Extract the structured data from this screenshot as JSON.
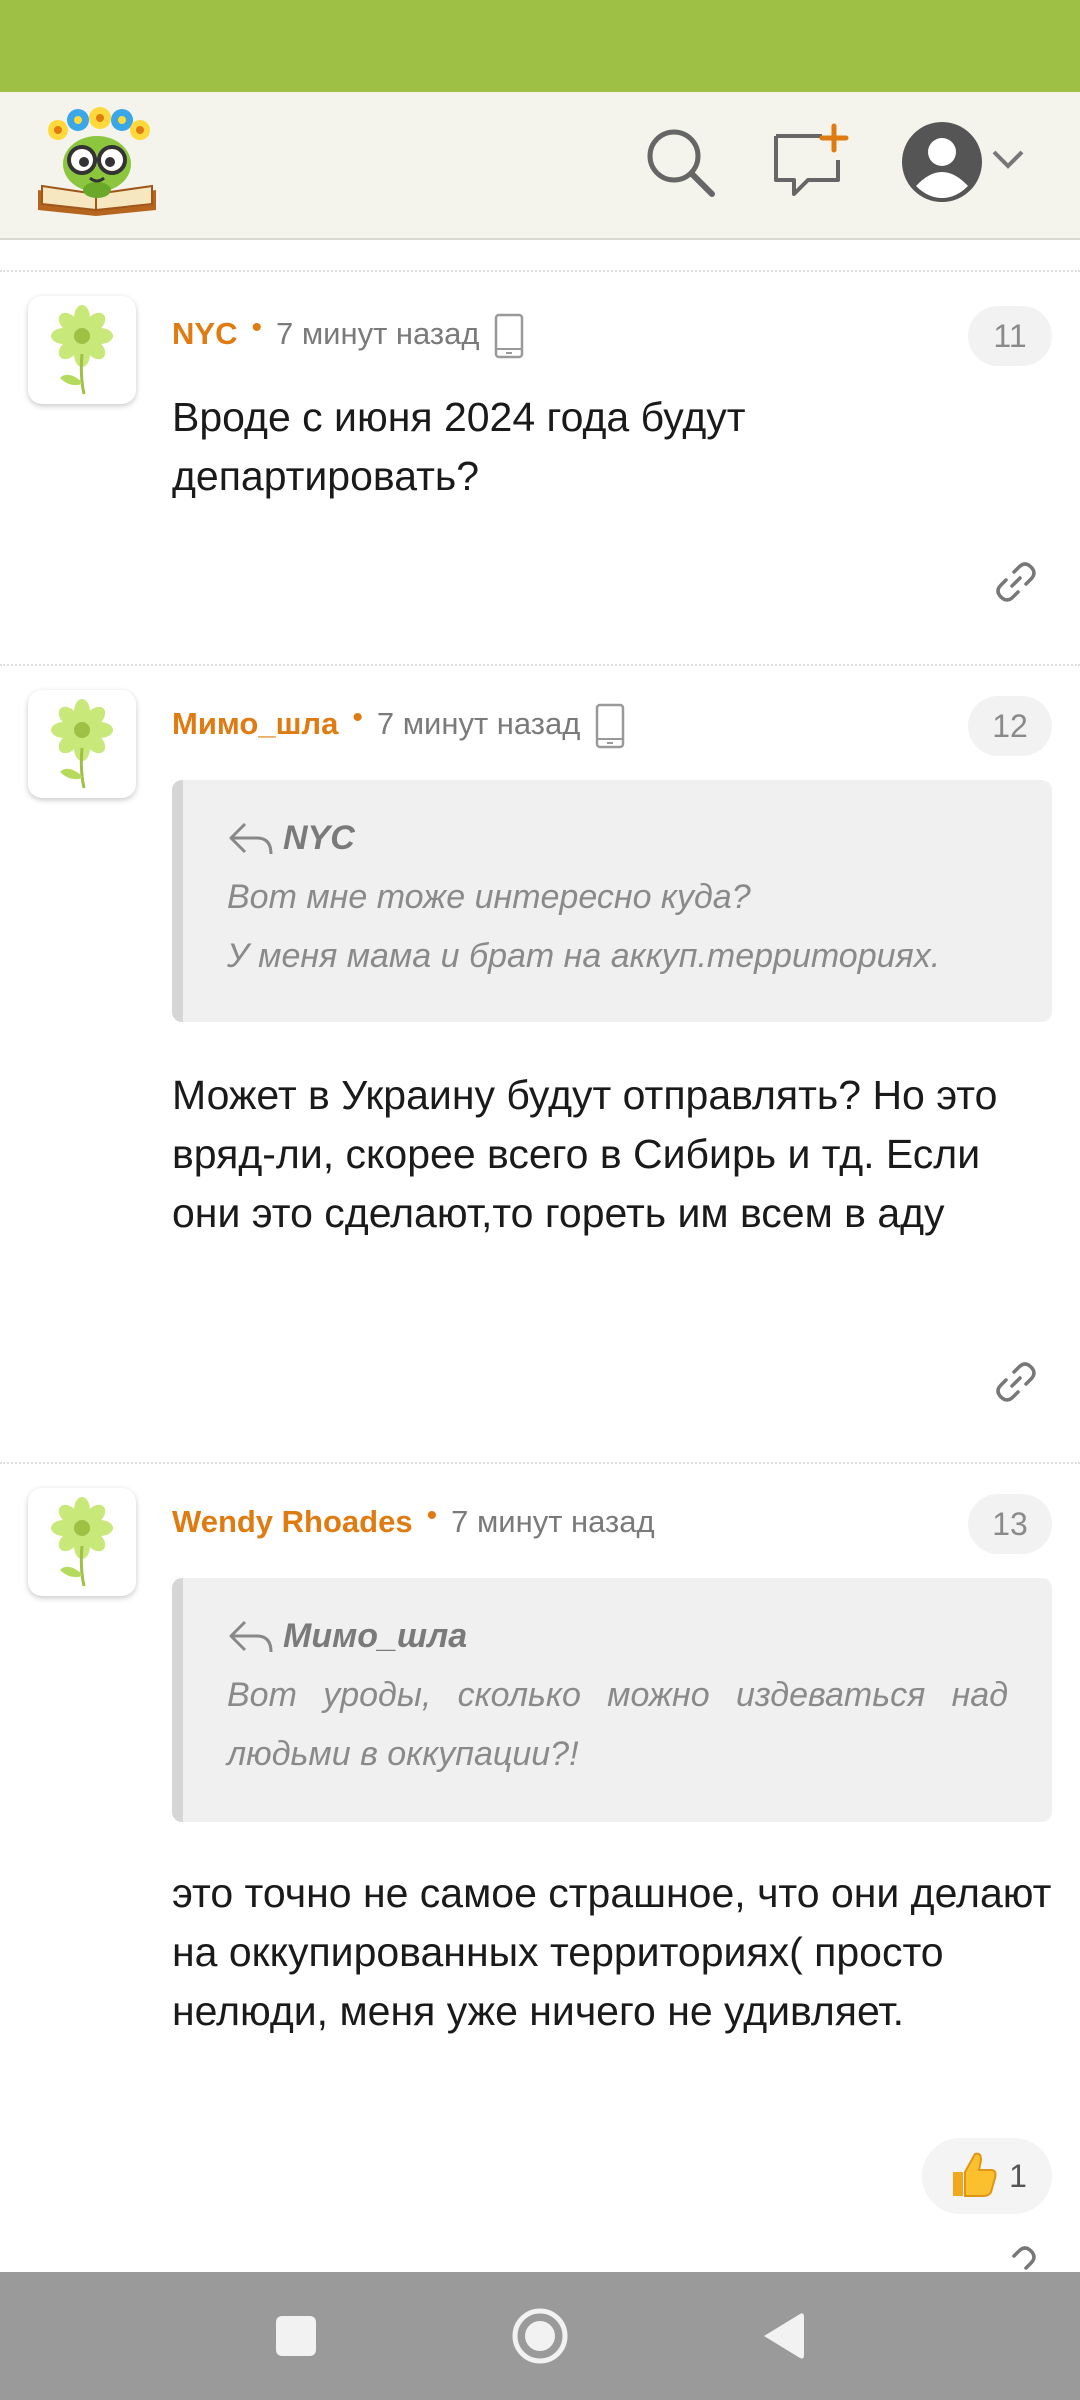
{
  "header": {
    "logo_icon": "book-flower-mascot-logo",
    "search_icon": "search-icon",
    "new_post_icon": "new-comment-icon",
    "profile_icon": "user-avatar-icon",
    "menu_icon": "chevron-down-icon"
  },
  "comments": [
    {
      "author": "NYC",
      "time": "7 минут назад",
      "device": "phone-icon",
      "number": "11",
      "text": "Вроде с июня 2024 года будут департировать?"
    },
    {
      "author": "Мимо_шла",
      "time": "7 минут назад",
      "device": "phone-icon",
      "number": "12",
      "quote": {
        "author": "NYC",
        "lines": [
          "Вот мне тоже интересно куда?",
          "У меня мама и брат на аккуп.территориях."
        ]
      },
      "text": "Может в Украину будут отправлять? Но это вряд-ли, скорее всего в Сибирь и тд. Если они это сделают,то гореть им всем в аду"
    },
    {
      "author": "Wendy Rhoades",
      "time": "7 минут назад",
      "number": "13",
      "quote": {
        "author": "Мимо_шла",
        "text": "Вот уроды, сколько можно издеваться над людьми в оккупации?!"
      },
      "text": "это точно не самое страшное, что они делают на оккупированных территориях( просто нелюди, меня уже ничего не удивляет.",
      "reaction": {
        "icon": "thumbs-up-icon",
        "count": "1"
      }
    }
  ],
  "colors": {
    "status_bar": "#9dc045",
    "header_bg": "#f4f4ec",
    "author": "#e07b12",
    "nav_bar": "#9a9a9a"
  }
}
